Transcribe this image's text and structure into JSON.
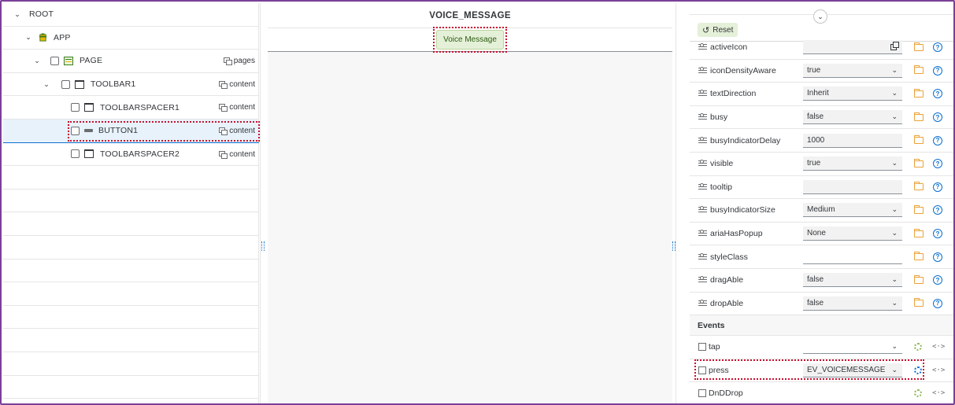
{
  "tree": {
    "rows": [
      {
        "label": "ROOT",
        "chevron": "⌄",
        "aggregation": ""
      },
      {
        "label": "APP",
        "chevron": "⌄",
        "aggregation": ""
      },
      {
        "label": "PAGE",
        "chevron": "⌄",
        "aggregation": "pages"
      },
      {
        "label": "TOOLBAR1",
        "chevron": "⌄",
        "aggregation": "content"
      },
      {
        "label": "TOOLBARSPACER1",
        "chevron": "",
        "aggregation": "content"
      },
      {
        "label": "BUTTON1",
        "chevron": "",
        "aggregation": "content"
      },
      {
        "label": "TOOLBARSPACER2",
        "chevron": "",
        "aggregation": "content"
      }
    ]
  },
  "canvas": {
    "title": "VOICE_MESSAGE",
    "button_label": "Voice Message"
  },
  "props": {
    "reset_label": "Reset",
    "reset_icon": "undo-icon",
    "rows": [
      {
        "name": "activeIcon",
        "value": "",
        "type": "text-ext"
      },
      {
        "name": "iconDensityAware",
        "value": "true",
        "type": "select"
      },
      {
        "name": "textDirection",
        "value": "Inherit",
        "type": "select"
      },
      {
        "name": "busy",
        "value": "false",
        "type": "select"
      },
      {
        "name": "busyIndicatorDelay",
        "value": "1000",
        "type": "text"
      },
      {
        "name": "visible",
        "value": "true",
        "type": "select"
      },
      {
        "name": "tooltip",
        "value": "",
        "type": "text"
      },
      {
        "name": "busyIndicatorSize",
        "value": "Medium",
        "type": "select"
      },
      {
        "name": "ariaHasPopup",
        "value": "None",
        "type": "select"
      },
      {
        "name": "styleClass",
        "value": "",
        "type": "text"
      },
      {
        "name": "dragAble",
        "value": "false",
        "type": "select"
      },
      {
        "name": "dropAble",
        "value": "false",
        "type": "select"
      }
    ],
    "events_title": "Events",
    "events": [
      {
        "name": "tap",
        "value": "",
        "has_select": true
      },
      {
        "name": "press",
        "value": "EV_VOICEMESSAGE",
        "has_select": true
      },
      {
        "name": "DnDDrop",
        "value": "",
        "has_select": false
      }
    ]
  },
  "colors": {
    "frame": "#7a3e98",
    "highlight": "#c8102e",
    "accent": "#0a6ed1",
    "button_bg": "#e5f0d8"
  }
}
